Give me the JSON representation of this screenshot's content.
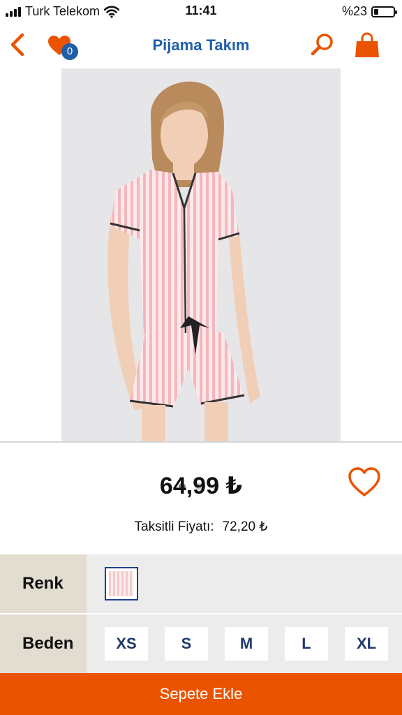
{
  "status_bar": {
    "carrier": "Turk Telekom",
    "time": "11:41",
    "battery": "%23",
    "battery_level": 0.23,
    "icons": [
      "signal-icon",
      "wifi-icon",
      "battery-icon"
    ]
  },
  "nav": {
    "title": "Pijama Takım",
    "favorites_count": "0",
    "accent_color": "#ea5400",
    "title_color": "#1f5fa8",
    "icons": [
      "back-chevron-icon",
      "heart-icon",
      "search-icon",
      "shopping-bag-icon"
    ]
  },
  "gallery": {
    "image_count": 3,
    "active_index": 0
  },
  "product": {
    "price": "64,99 ₺",
    "installment_label": "Taksitli Fiyatı:",
    "installment_price": "72,20 ₺"
  },
  "options": {
    "color_label": "Renk",
    "size_label": "Beden",
    "sizes": [
      "XS",
      "S",
      "M",
      "L",
      "XL"
    ]
  },
  "actions": {
    "add_to_cart": "Sepete Ekle",
    "button_color": "#ea5400"
  }
}
